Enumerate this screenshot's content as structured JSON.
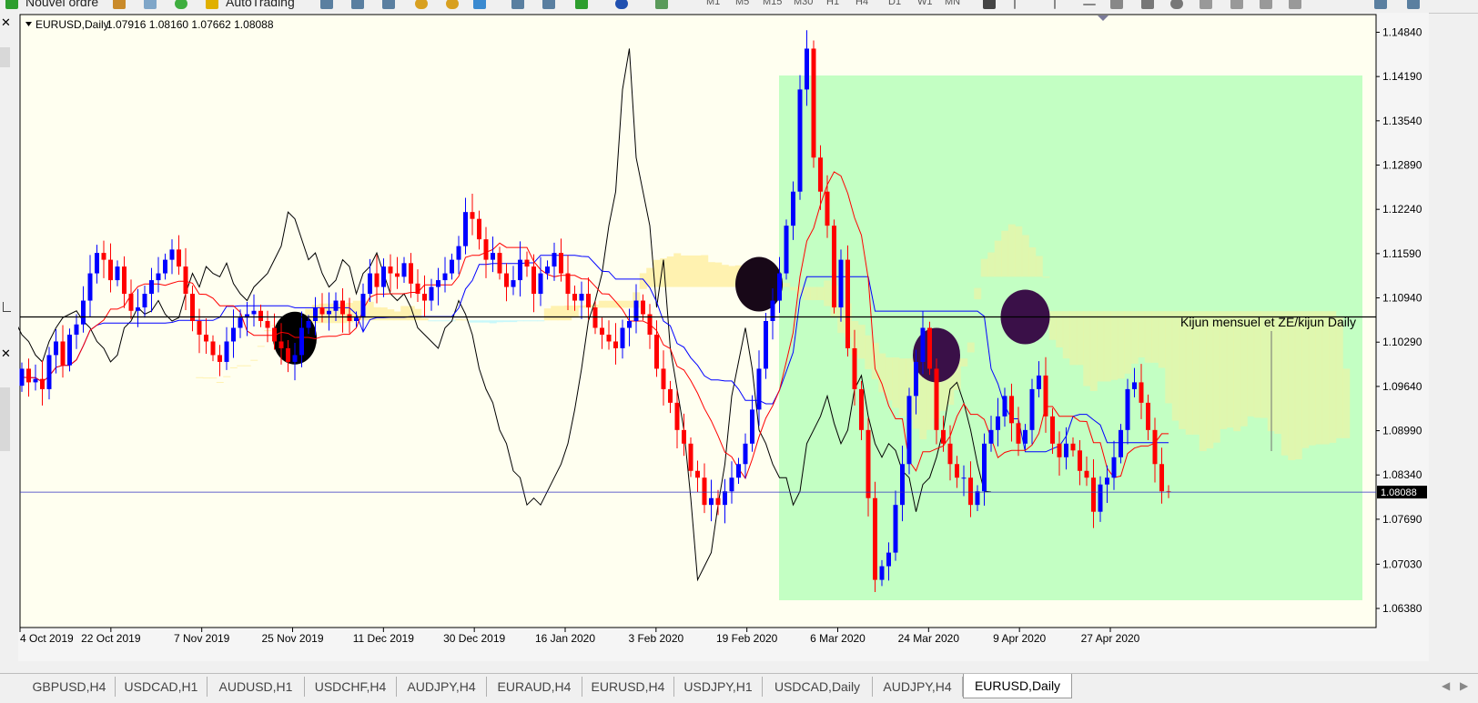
{
  "toolbar": {
    "new_order": "Nouvel ordre",
    "autotrading": "AutoTrading",
    "timeframes": [
      "M1",
      "M5",
      "M15",
      "M30",
      "H1",
      "H4",
      "D1",
      "W1",
      "MN"
    ],
    "icons": [
      "new-order-icon",
      "market-watch-icon",
      "history-icon",
      "autotrading-icon",
      "zoom-in-icon",
      "zoom-out-icon",
      "tile-windows-icon",
      "chart-shift-icon",
      "auto-scroll-icon",
      "indicators-icon",
      "period-icon",
      "templates-icon",
      "cursor-icon",
      "vertical-line-icon",
      "horizontal-line-icon",
      "trendline-icon",
      "rectangle-icon",
      "ellipse-icon",
      "text-icon",
      "label-icon",
      "arrows-icon"
    ]
  },
  "chart_header": {
    "symbol": "EURUSD,Daily",
    "ohlc": "1.07916 1.08160 1.07662 1.08088"
  },
  "annotation_text": "Kijun mensuel et ZE/kijun Daily",
  "current_price_label": "1.08088",
  "colors": {
    "background": "#fffff0",
    "bull": "#0000ff",
    "bear": "#ff0000",
    "tenkan": "#ff0000",
    "kijun": "#0000ff",
    "chikou": "#000000",
    "kumo_bull": "#fff2b0",
    "kumo_bear": "#c8f8fa",
    "zone": "#c0ffc0",
    "ellipse_dark": "#3a1048",
    "price_line": "#3030c0"
  },
  "tabs": [
    "GBPUSD,H4",
    "USDCAD,H1",
    "AUDUSD,H1",
    "USDCHF,H4",
    "AUDJPY,H4",
    "EURAUD,H4",
    "EURUSD,H4",
    "USDJPY,H1",
    "USDCAD,Daily",
    "AUDJPY,H4",
    "EURUSD,Daily"
  ],
  "active_tab": "EURUSD,Daily",
  "chart_data": {
    "type": "candlestick",
    "symbol": "EURUSD",
    "timeframe": "Daily",
    "ylim": [
      1.061,
      1.151
    ],
    "y_ticks": [
      "1.14840",
      "1.14190",
      "1.13540",
      "1.12890",
      "1.12240",
      "1.11590",
      "1.10940",
      "1.10290",
      "1.09640",
      "1.08990",
      "1.08340",
      "1.07690",
      "1.07030",
      "1.06380"
    ],
    "x_ticks": [
      "4 Oct 2019",
      "22 Oct 2019",
      "7 Nov 2019",
      "25 Nov 2019",
      "11 Dec 2019",
      "30 Dec 2019",
      "16 Jan 2020",
      "3 Feb 2020",
      "19 Feb 2020",
      "6 Mar 2020",
      "24 Mar 2020",
      "9 Apr 2020",
      "27 Apr 2020"
    ],
    "last_price": 1.08088,
    "horizontal_line": 1.1066,
    "closes": [
      1.099,
      1.097,
      1.0975,
      1.096,
      1.101,
      1.103,
      1.0995,
      1.104,
      1.1055,
      1.109,
      1.113,
      1.116,
      1.115,
      1.112,
      1.114,
      1.11,
      1.1075,
      1.108,
      1.11,
      1.112,
      1.113,
      1.115,
      1.1165,
      1.114,
      1.11,
      1.106,
      1.104,
      1.103,
      1.101,
      1.1,
      1.103,
      1.105,
      1.1065,
      1.107,
      1.1075,
      1.106,
      1.105,
      1.103,
      1.102,
      1.1,
      1.101,
      1.105,
      1.106,
      1.108,
      1.107,
      1.1075,
      1.109,
      1.107,
      1.106,
      1.1065,
      1.11,
      1.113,
      1.111,
      1.114,
      1.113,
      1.1125,
      1.1145,
      1.1115,
      1.11,
      1.109,
      1.111,
      1.112,
      1.113,
      1.115,
      1.117,
      1.122,
      1.121,
      1.118,
      1.115,
      1.116,
      1.113,
      1.111,
      1.112,
      1.115,
      1.114,
      1.11,
      1.113,
      1.114,
      1.116,
      1.113,
      1.11,
      1.109,
      1.11,
      1.108,
      1.105,
      1.104,
      1.103,
      1.102,
      1.105,
      1.106,
      1.109,
      1.107,
      1.104,
      1.099,
      1.096,
      1.094,
      1.09,
      1.088,
      1.084,
      1.083,
      1.079,
      1.08,
      1.079,
      1.081,
      1.083,
      1.085,
      1.088,
      1.093,
      1.099,
      1.106,
      1.109,
      1.113,
      1.12,
      1.125,
      1.14,
      1.146,
      1.13,
      1.125,
      1.12,
      1.108,
      1.115,
      1.102,
      1.096,
      1.09,
      1.08,
      1.068,
      1.07,
      1.072,
      1.079,
      1.085,
      1.095,
      1.1,
      1.105,
      1.099,
      1.09,
      1.088,
      1.085,
      1.083,
      1.083,
      1.079,
      1.081,
      1.088,
      1.09,
      1.092,
      1.095,
      1.091,
      1.088,
      1.09,
      1.096,
      1.098,
      1.092,
      1.088,
      1.086,
      1.088,
      1.087,
      1.084,
      1.083,
      1.078,
      1.082,
      1.083,
      1.086,
      1.09,
      1.096,
      1.097,
      1.094,
      1.09,
      1.085,
      1.081,
      1.0809
    ]
  }
}
